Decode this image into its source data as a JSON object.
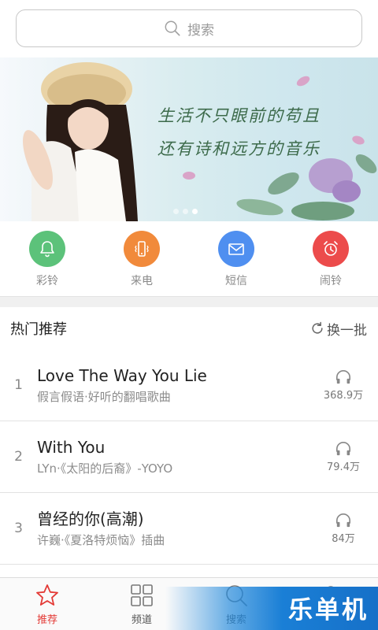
{
  "search": {
    "placeholder": "搜索"
  },
  "banner": {
    "line1": "生活不只眼前的苟且",
    "line2": "还有诗和远方的音乐",
    "slide_count": 3,
    "active_slide": 3
  },
  "categories": [
    {
      "label": "彩铃",
      "color": "#5cc27a",
      "icon": "bell-icon"
    },
    {
      "label": "来电",
      "color": "#f18a3b",
      "icon": "phone-vibrate-icon"
    },
    {
      "label": "短信",
      "color": "#4f8ff0",
      "icon": "envelope-icon"
    },
    {
      "label": "闹铃",
      "color": "#ec4b4b",
      "icon": "alarm-clock-icon"
    }
  ],
  "hot": {
    "title": "热门推荐",
    "refresh_label": "换一批",
    "songs": [
      {
        "rank": "1",
        "title": "Love The Way You Lie",
        "subtitle": "假言假语·好听的翻唱歌曲",
        "plays": "368.9万"
      },
      {
        "rank": "2",
        "title": "With You",
        "subtitle": "LYn·《太阳的后裔》-YOYO",
        "plays": "79.4万"
      },
      {
        "rank": "3",
        "title": "曾经的你(高潮)",
        "subtitle": "许巍·《夏洛特烦恼》插曲",
        "plays": "84万"
      }
    ]
  },
  "tabs": [
    {
      "label": "推荐",
      "icon": "star-icon",
      "active": true
    },
    {
      "label": "频道",
      "icon": "grid-icon",
      "active": false
    },
    {
      "label": "搜索",
      "icon": "search-icon",
      "active": false
    },
    {
      "label": "",
      "icon": "user-icon",
      "active": false
    }
  ],
  "watermark": {
    "text": "乐单机"
  },
  "colors": {
    "accent": "#e33a36"
  }
}
